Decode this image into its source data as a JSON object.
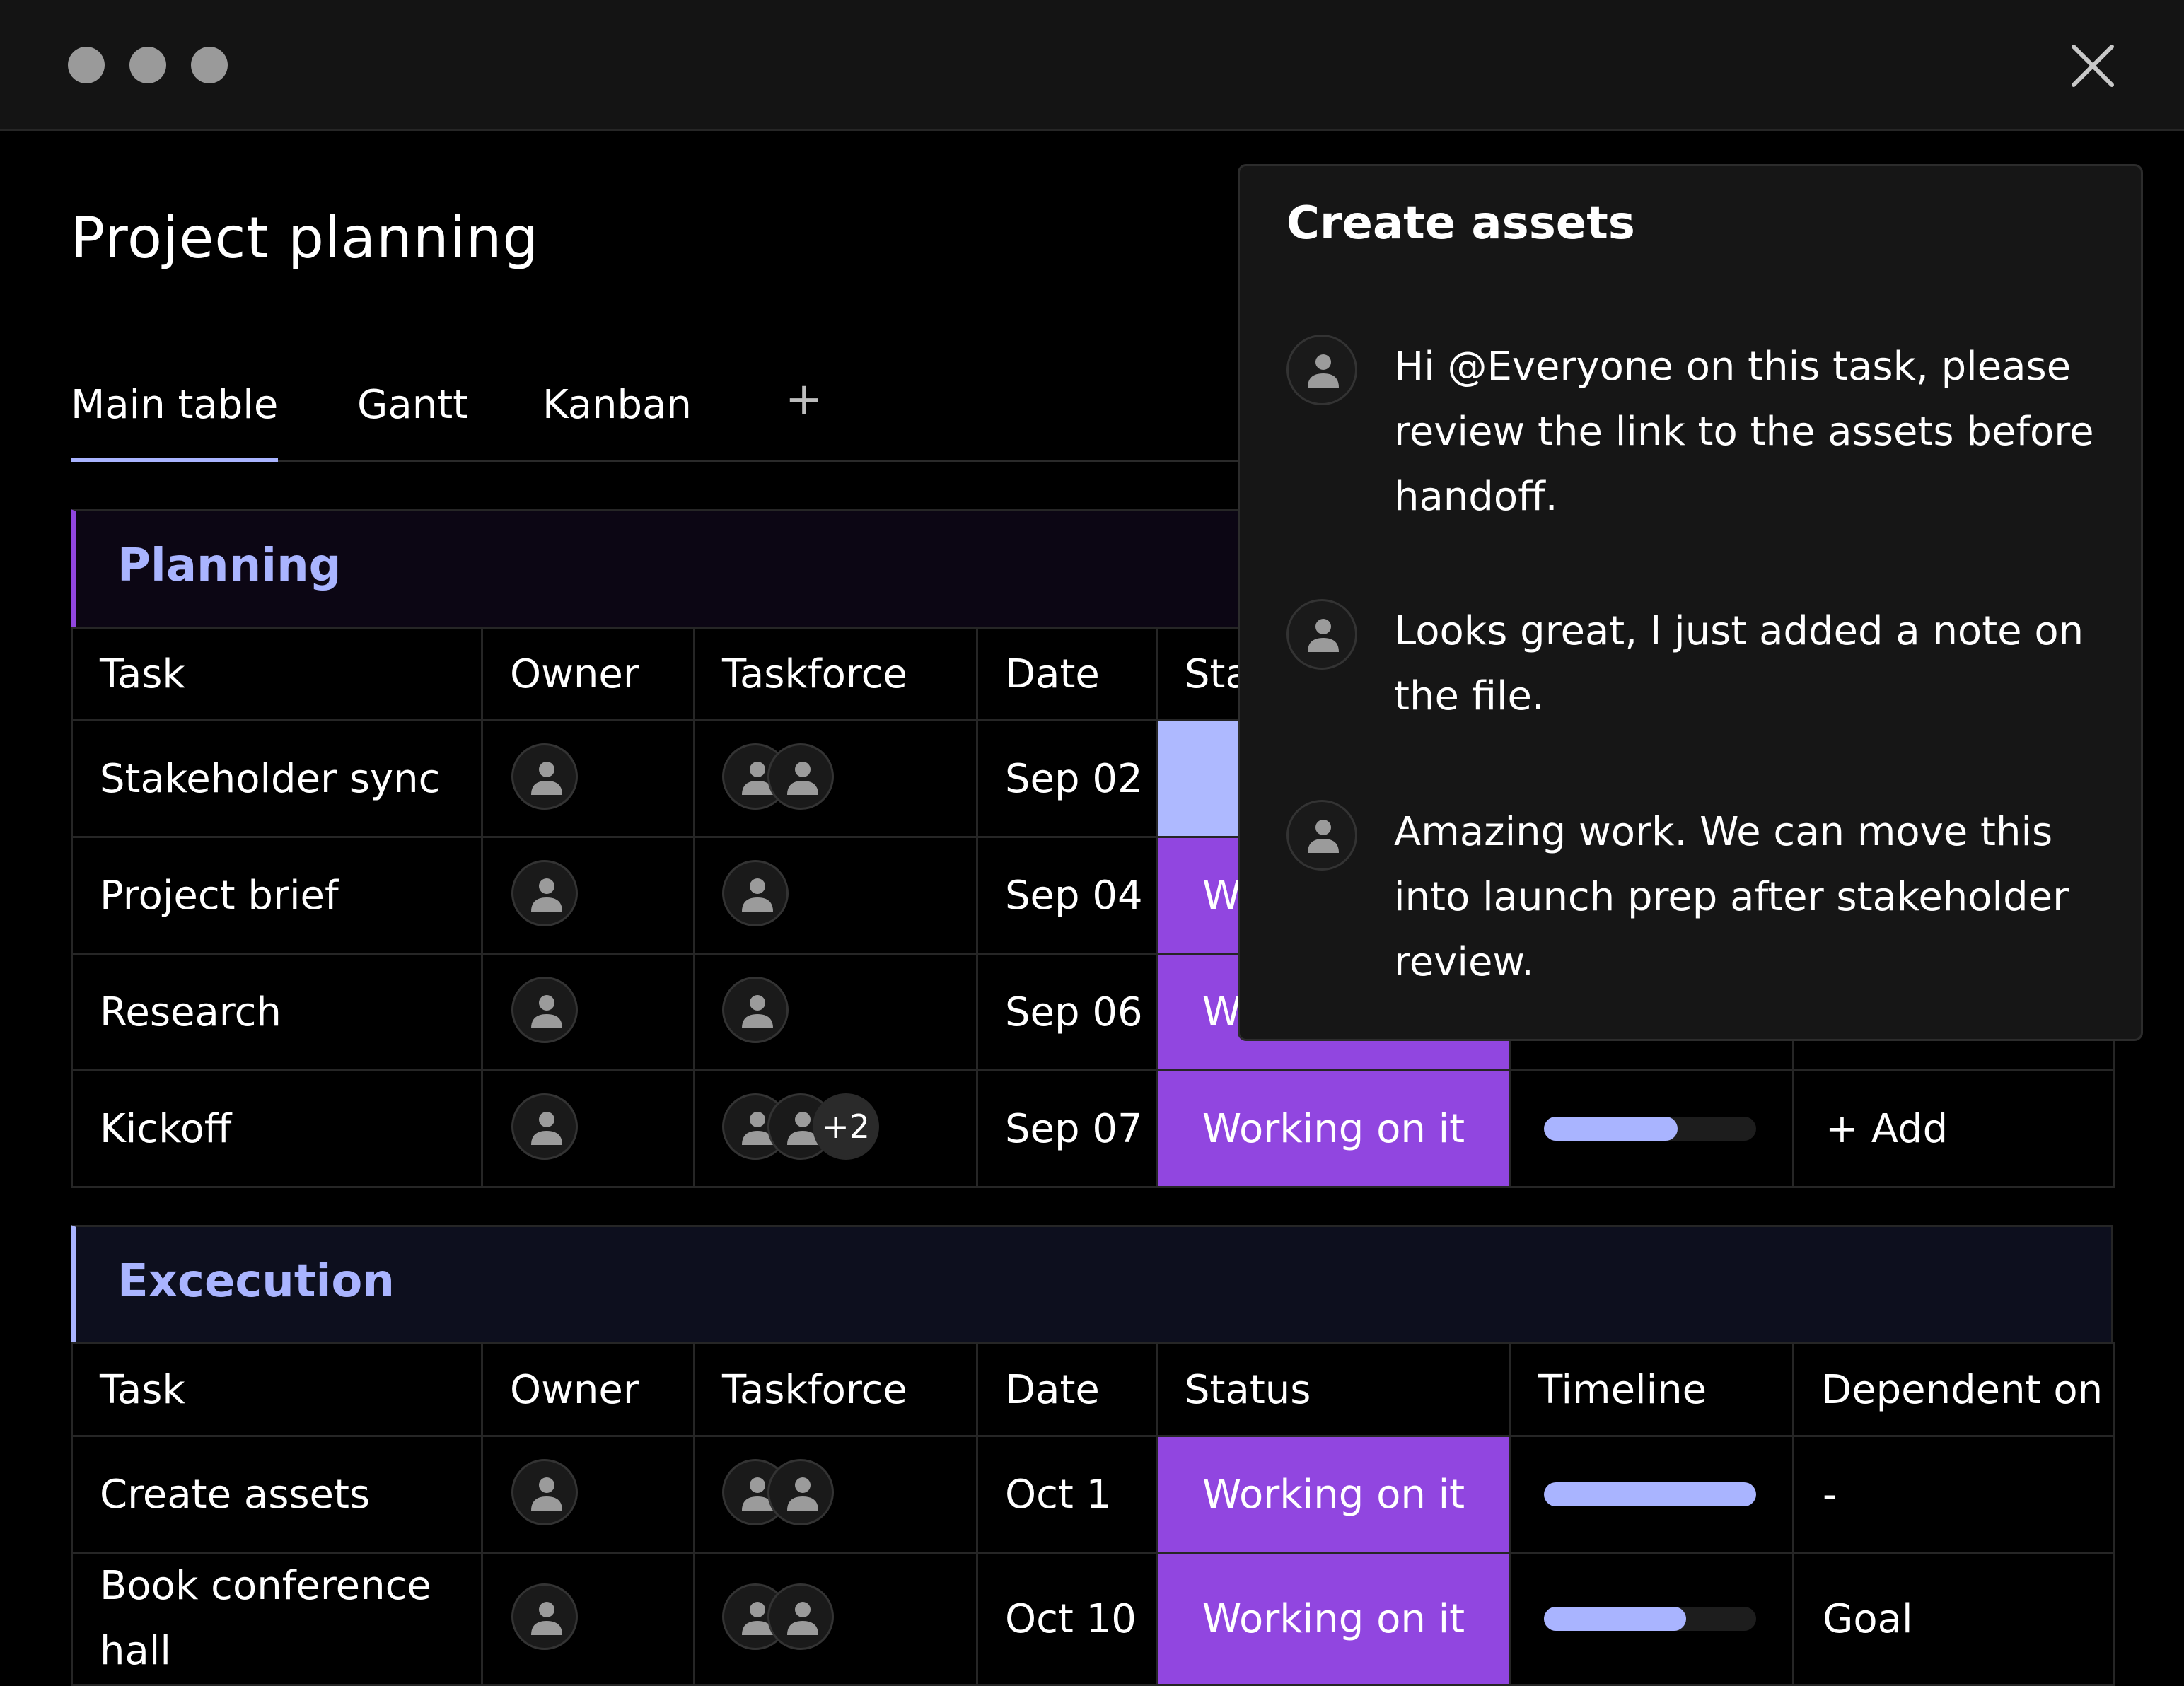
{
  "window": {
    "controls": [
      "dot",
      "dot",
      "dot"
    ],
    "close_icon": "close-icon"
  },
  "page": {
    "title": "Project planning"
  },
  "tabs": [
    {
      "label": "Main table",
      "active": true
    },
    {
      "label": "Gantt",
      "active": false
    },
    {
      "label": "Kanban",
      "active": false
    }
  ],
  "add_tab_label": "+",
  "columns": [
    "Task",
    "Owner",
    "Taskforce",
    "Date",
    "Status",
    "Timeline",
    "Dependent on"
  ],
  "groups": [
    {
      "title": "Planning",
      "accent": "#9146e0",
      "header_bg": "#0c0614",
      "rows": [
        {
          "task": "Stakeholder sync",
          "taskforce_count": 2,
          "taskforce_more": "",
          "date": "Sep 02",
          "status": "",
          "status_light": true,
          "timeline": 0,
          "dependent": ""
        },
        {
          "task": "Project brief",
          "taskforce_count": 1,
          "taskforce_more": "",
          "date": "Sep 04",
          "status": "Working on it",
          "status_light": false,
          "timeline": 0,
          "dependent": ""
        },
        {
          "task": "Research",
          "taskforce_count": 1,
          "taskforce_more": "",
          "date": "Sep 06",
          "status": "Working on it",
          "status_light": false,
          "timeline": 0,
          "dependent": ""
        },
        {
          "task": "Kickoff",
          "taskforce_count": 2,
          "taskforce_more": "+2",
          "date": "Sep 07",
          "status": "Working on it",
          "status_light": false,
          "timeline": 0.63,
          "dependent": "+ Add"
        }
      ]
    },
    {
      "title": "Excecution",
      "accent": "#a9b4ff",
      "header_bg": "#0d0f1e",
      "rows": [
        {
          "task": "Create assets",
          "taskforce_count": 2,
          "taskforce_more": "",
          "date": "Oct 1",
          "status": "Working on it",
          "status_light": false,
          "timeline": 1.0,
          "dependent": "-"
        },
        {
          "task": "Book conference hall",
          "taskforce_count": 2,
          "taskforce_more": "",
          "date": "Oct 10",
          "status": "Working on it",
          "status_light": false,
          "timeline": 0.67,
          "dependent": "Goal"
        }
      ]
    }
  ],
  "comments": {
    "title": "Create assets",
    "items": [
      {
        "text": "Hi @Everyone on this task, please review the link to the assets before handoff."
      },
      {
        "text": "Looks great, I just added a note on the file."
      },
      {
        "text": "Amazing work. We can move this into launch prep after stakeholder review."
      }
    ]
  }
}
